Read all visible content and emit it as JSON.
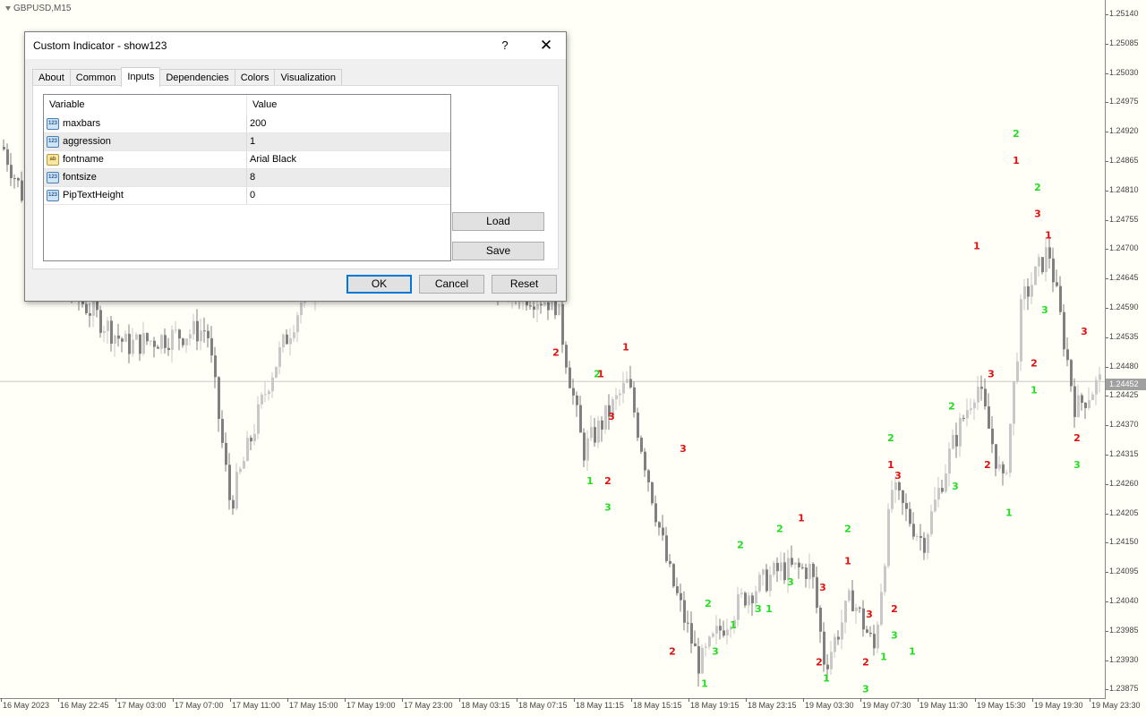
{
  "chart": {
    "symbol": "GBPUSD,M15",
    "current_price": "1.24452",
    "price_ticks": [
      "1.25140",
      "1.25085",
      "1.25030",
      "1.24975",
      "1.24920",
      "1.24865",
      "1.24810",
      "1.24755",
      "1.24700",
      "1.24645",
      "1.24590",
      "1.24535",
      "1.24480",
      "1.24425",
      "1.24370",
      "1.24315",
      "1.24260",
      "1.24205",
      "1.24150",
      "1.24095",
      "1.24040",
      "1.23985",
      "1.23930",
      "1.23875"
    ],
    "time_ticks": [
      "16 May 2023",
      "16 May 22:45",
      "17 May 03:00",
      "17 May 07:00",
      "17 May 11:00",
      "17 May 15:00",
      "17 May 19:00",
      "17 May 23:00",
      "18 May 03:15",
      "18 May 07:15",
      "18 May 11:15",
      "18 May 15:15",
      "18 May 19:15",
      "18 May 23:15",
      "19 May 03:30",
      "19 May 07:30",
      "19 May 11:30",
      "19 May 15:30",
      "19 May 19:30",
      "19 May 23:30"
    ],
    "bull_color": "#c8c8c8",
    "bear_color": "#808080",
    "green_label_color": "#22dd22",
    "red_label_color": "#dd1111",
    "markers": [
      {
        "text": "2",
        "color": "red",
        "bar": 621,
        "price": 1.245
      },
      {
        "text": "2",
        "color": "green",
        "bar": 667,
        "price": 1.2446
      },
      {
        "text": "1",
        "color": "red",
        "bar": 671,
        "price": 1.2446
      },
      {
        "text": "1",
        "color": "red",
        "bar": 699,
        "price": 1.2451
      },
      {
        "text": "3",
        "color": "red",
        "bar": 683,
        "price": 1.2438
      },
      {
        "text": "1",
        "color": "green",
        "bar": 659,
        "price": 1.2426
      },
      {
        "text": "2",
        "color": "red",
        "bar": 679,
        "price": 1.2426
      },
      {
        "text": "3",
        "color": "green",
        "bar": 679,
        "price": 1.2421
      },
      {
        "text": "3",
        "color": "red",
        "bar": 763,
        "price": 1.2432
      },
      {
        "text": "2",
        "color": "red",
        "bar": 751,
        "price": 1.2394
      },
      {
        "text": "1",
        "color": "green",
        "bar": 787,
        "price": 1.2388
      },
      {
        "text": "2",
        "color": "green",
        "bar": 791,
        "price": 1.2403
      },
      {
        "text": "3",
        "color": "green",
        "bar": 799,
        "price": 1.2394
      },
      {
        "text": "1",
        "color": "green",
        "bar": 819,
        "price": 1.2399
      },
      {
        "text": "2",
        "color": "green",
        "bar": 827,
        "price": 1.2414
      },
      {
        "text": "3",
        "color": "green",
        "bar": 847,
        "price": 1.2402
      },
      {
        "text": "1",
        "color": "green",
        "bar": 859,
        "price": 1.2402
      },
      {
        "text": "2",
        "color": "green",
        "bar": 871,
        "price": 1.2417
      },
      {
        "text": "3",
        "color": "green",
        "bar": 883,
        "price": 1.2407
      },
      {
        "text": "1",
        "color": "red",
        "bar": 895,
        "price": 1.2419
      },
      {
        "text": "3",
        "color": "red",
        "bar": 919,
        "price": 1.2406
      },
      {
        "text": "2",
        "color": "red",
        "bar": 915,
        "price": 1.2392
      },
      {
        "text": "1",
        "color": "green",
        "bar": 923,
        "price": 1.2389
      },
      {
        "text": "2",
        "color": "green",
        "bar": 947,
        "price": 1.2417
      },
      {
        "text": "1",
        "color": "red",
        "bar": 947,
        "price": 1.2411
      },
      {
        "text": "2",
        "color": "red",
        "bar": 967,
        "price": 1.2392
      },
      {
        "text": "3",
        "color": "red",
        "bar": 971,
        "price": 1.2401
      },
      {
        "text": "3",
        "color": "green",
        "bar": 967,
        "price": 1.2387
      },
      {
        "text": "1",
        "color": "green",
        "bar": 987,
        "price": 1.2393
      },
      {
        "text": "3",
        "color": "green",
        "bar": 999,
        "price": 1.2397
      },
      {
        "text": "2",
        "color": "red",
        "bar": 999,
        "price": 1.2402
      },
      {
        "text": "2",
        "color": "green",
        "bar": 995,
        "price": 1.2434
      },
      {
        "text": "1",
        "color": "red",
        "bar": 995,
        "price": 1.2429
      },
      {
        "text": "3",
        "color": "red",
        "bar": 1003,
        "price": 1.2427
      },
      {
        "text": "1",
        "color": "green",
        "bar": 1019,
        "price": 1.2394
      },
      {
        "text": "3",
        "color": "green",
        "bar": 1067,
        "price": 1.2425
      },
      {
        "text": "2",
        "color": "green",
        "bar": 1063,
        "price": 1.244
      },
      {
        "text": "1",
        "color": "red",
        "bar": 1091,
        "price": 1.247
      },
      {
        "text": "3",
        "color": "red",
        "bar": 1107,
        "price": 1.2446
      },
      {
        "text": "2",
        "color": "red",
        "bar": 1103,
        "price": 1.2429
      },
      {
        "text": "1",
        "color": "green",
        "bar": 1127,
        "price": 1.242
      },
      {
        "text": "2",
        "color": "green",
        "bar": 1135,
        "price": 1.2491
      },
      {
        "text": "1",
        "color": "red",
        "bar": 1135,
        "price": 1.2486
      },
      {
        "text": "2",
        "color": "green",
        "bar": 1159,
        "price": 1.2481
      },
      {
        "text": "3",
        "color": "red",
        "bar": 1159,
        "price": 1.2476
      },
      {
        "text": "1",
        "color": "red",
        "bar": 1171,
        "price": 1.2472
      },
      {
        "text": "3",
        "color": "green",
        "bar": 1167,
        "price": 1.2458
      },
      {
        "text": "2",
        "color": "red",
        "bar": 1155,
        "price": 1.2448
      },
      {
        "text": "1",
        "color": "green",
        "bar": 1155,
        "price": 1.2443
      },
      {
        "text": "3",
        "color": "red",
        "bar": 1211,
        "price": 1.2454
      },
      {
        "text": "2",
        "color": "red",
        "bar": 1203,
        "price": 1.2434
      },
      {
        "text": "3",
        "color": "green",
        "bar": 1203,
        "price": 1.2429
      }
    ]
  },
  "dialog": {
    "title": "Custom Indicator - show123",
    "help_label": "?",
    "close_label": "✕",
    "tabs": [
      "About",
      "Common",
      "Inputs",
      "Dependencies",
      "Colors",
      "Visualization"
    ],
    "active_tab": "Inputs",
    "columns": {
      "variable": "Variable",
      "value": "Value"
    },
    "params": [
      {
        "type": "int",
        "icon_text": "123",
        "name": "maxbars",
        "value": "200"
      },
      {
        "type": "int",
        "icon_text": "123",
        "name": "aggression",
        "value": "1"
      },
      {
        "type": "str",
        "icon_text": "ab",
        "name": "fontname",
        "value": "Arial Black"
      },
      {
        "type": "int",
        "icon_text": "123",
        "name": "fontsize",
        "value": "8"
      },
      {
        "type": "int",
        "icon_text": "123",
        "name": "PipTextHeight",
        "value": "0"
      }
    ],
    "load_label": "Load",
    "save_label": "Save",
    "ok_label": "OK",
    "cancel_label": "Cancel",
    "reset_label": "Reset"
  }
}
